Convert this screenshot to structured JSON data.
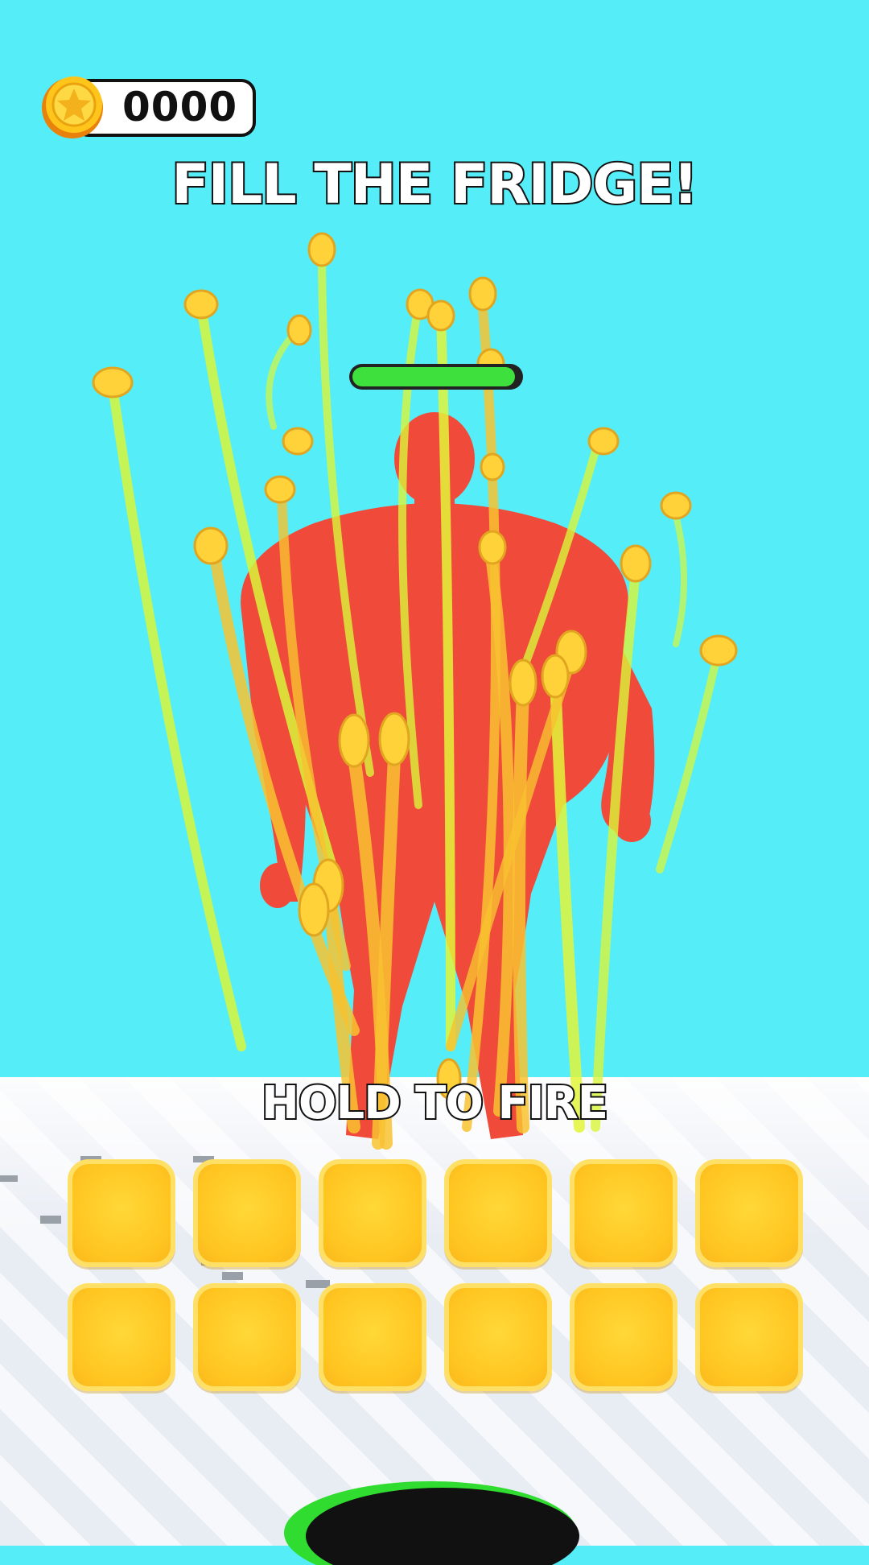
{
  "hud": {
    "coins": "0000",
    "coin_icon": "star-coin-icon",
    "title": "FILL THE FRIDGE!",
    "hint": "HOLD TO FIRE",
    "boss_health": 0.97
  },
  "slots": [
    {
      "id": "slot-1"
    },
    {
      "id": "slot-2"
    },
    {
      "id": "slot-3"
    },
    {
      "id": "slot-4"
    },
    {
      "id": "slot-5"
    },
    {
      "id": "slot-6"
    },
    {
      "id": "slot-7"
    },
    {
      "id": "slot-8"
    },
    {
      "id": "slot-9"
    },
    {
      "id": "slot-10"
    },
    {
      "id": "slot-11"
    },
    {
      "id": "slot-12"
    }
  ],
  "colors": {
    "sky": "#55EEF8",
    "boss": "#F04A3A",
    "slot": "#FFC520",
    "health": "#3EE03E",
    "projectile": "#FFD23A"
  }
}
